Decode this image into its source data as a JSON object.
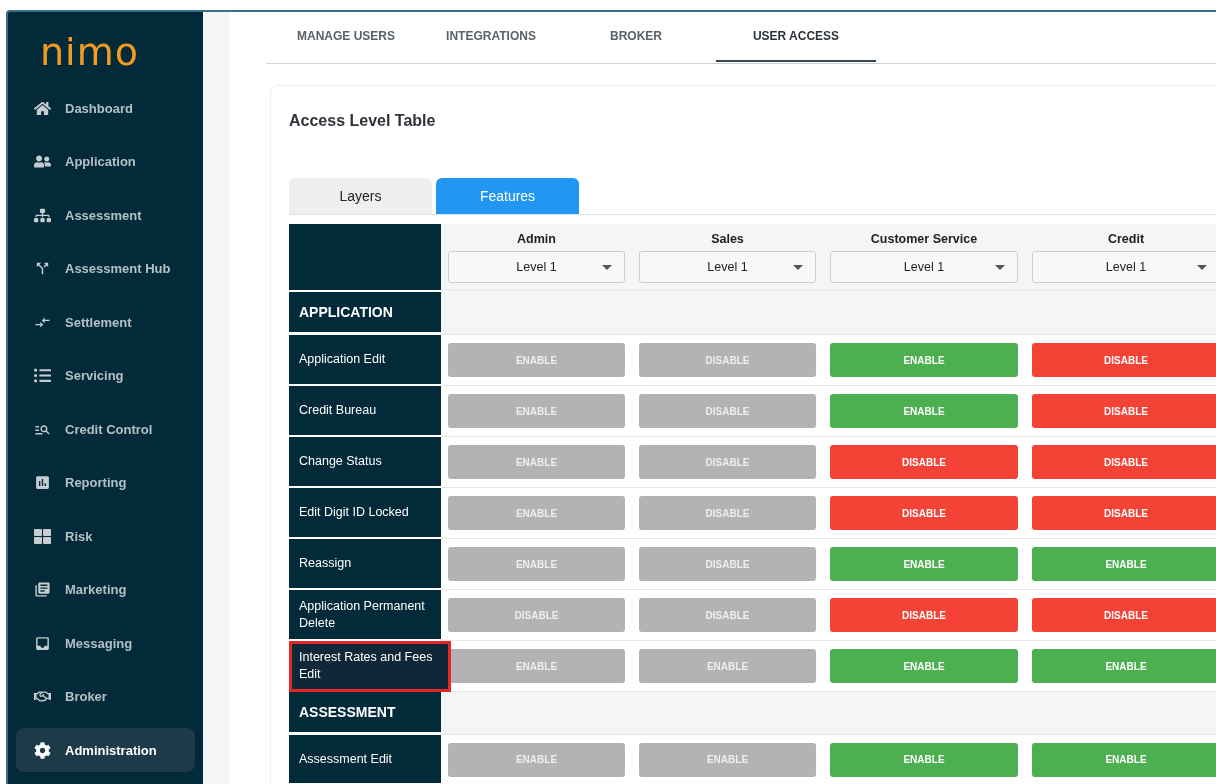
{
  "brand": "nimo",
  "sidebar": {
    "items": [
      {
        "label": "Dashboard",
        "selected": false
      },
      {
        "label": "Application",
        "selected": false
      },
      {
        "label": "Assessment",
        "selected": false
      },
      {
        "label": "Assessment Hub",
        "selected": false
      },
      {
        "label": "Settlement",
        "selected": false
      },
      {
        "label": "Servicing",
        "selected": false
      },
      {
        "label": "Credit Control",
        "selected": false
      },
      {
        "label": "Reporting",
        "selected": false
      },
      {
        "label": "Risk",
        "selected": false
      },
      {
        "label": "Marketing",
        "selected": false
      },
      {
        "label": "Messaging",
        "selected": false
      },
      {
        "label": "Broker",
        "selected": false
      },
      {
        "label": "Administration",
        "selected": true
      }
    ]
  },
  "top_tabs": [
    {
      "label": "MANAGE USERS",
      "selected": false
    },
    {
      "label": "INTEGRATIONS",
      "selected": false
    },
    {
      "label": "BROKER",
      "selected": false
    },
    {
      "label": "USER ACCESS",
      "selected": true
    }
  ],
  "card": {
    "title": "Access Level Table",
    "sub_tabs": [
      {
        "label": "Layers",
        "selected": false
      },
      {
        "label": "Features",
        "selected": true
      }
    ],
    "table": {
      "columns": [
        {
          "name": "Admin",
          "level": "Level 1"
        },
        {
          "name": "Sales",
          "level": "Level 1"
        },
        {
          "name": "Customer Service",
          "level": "Level 1"
        },
        {
          "name": "Credit",
          "level": "Level 1"
        }
      ],
      "rows": [
        {
          "kind": "section",
          "label": "APPLICATION"
        },
        {
          "kind": "feature",
          "label": "Application Edit",
          "highlighted": false,
          "cells": [
            {
              "label": "ENABLE",
              "kind": "inactive"
            },
            {
              "label": "DISABLE",
              "kind": "inactive"
            },
            {
              "label": "ENABLE",
              "kind": "allow"
            },
            {
              "label": "DISABLE",
              "kind": "deny"
            }
          ]
        },
        {
          "kind": "feature",
          "label": "Credit Bureau",
          "highlighted": false,
          "cells": [
            {
              "label": "ENABLE",
              "kind": "inactive"
            },
            {
              "label": "DISABLE",
              "kind": "inactive"
            },
            {
              "label": "ENABLE",
              "kind": "allow"
            },
            {
              "label": "DISABLE",
              "kind": "deny"
            }
          ]
        },
        {
          "kind": "feature",
          "label": "Change Status",
          "highlighted": false,
          "cells": [
            {
              "label": "ENABLE",
              "kind": "inactive"
            },
            {
              "label": "DISABLE",
              "kind": "inactive"
            },
            {
              "label": "DISABLE",
              "kind": "deny"
            },
            {
              "label": "DISABLE",
              "kind": "deny"
            }
          ]
        },
        {
          "kind": "feature",
          "label": "Edit Digit ID Locked",
          "highlighted": false,
          "cells": [
            {
              "label": "ENABLE",
              "kind": "inactive"
            },
            {
              "label": "DISABLE",
              "kind": "inactive"
            },
            {
              "label": "DISABLE",
              "kind": "deny"
            },
            {
              "label": "DISABLE",
              "kind": "deny"
            }
          ]
        },
        {
          "kind": "feature",
          "label": "Reassign",
          "highlighted": false,
          "cells": [
            {
              "label": "ENABLE",
              "kind": "inactive"
            },
            {
              "label": "DISABLE",
              "kind": "inactive"
            },
            {
              "label": "ENABLE",
              "kind": "allow"
            },
            {
              "label": "ENABLE",
              "kind": "allow"
            }
          ]
        },
        {
          "kind": "feature",
          "label": "Application Permanent Delete",
          "highlighted": false,
          "cells": [
            {
              "label": "DISABLE",
              "kind": "inactive"
            },
            {
              "label": "DISABLE",
              "kind": "inactive"
            },
            {
              "label": "DISABLE",
              "kind": "deny"
            },
            {
              "label": "DISABLE",
              "kind": "deny"
            }
          ]
        },
        {
          "kind": "feature",
          "label": "Interest Rates and Fees Edit",
          "highlighted": true,
          "cells": [
            {
              "label": "ENABLE",
              "kind": "inactive"
            },
            {
              "label": "ENABLE",
              "kind": "inactive"
            },
            {
              "label": "ENABLE",
              "kind": "allow"
            },
            {
              "label": "ENABLE",
              "kind": "allow"
            }
          ]
        },
        {
          "kind": "section",
          "label": "ASSESSMENT"
        },
        {
          "kind": "feature",
          "label": "Assessment Edit",
          "highlighted": false,
          "cells": [
            {
              "label": "ENABLE",
              "kind": "inactive"
            },
            {
              "label": "ENABLE",
              "kind": "inactive"
            },
            {
              "label": "ENABLE",
              "kind": "allow"
            },
            {
              "label": "ENABLE",
              "kind": "allow"
            }
          ]
        }
      ]
    }
  }
}
